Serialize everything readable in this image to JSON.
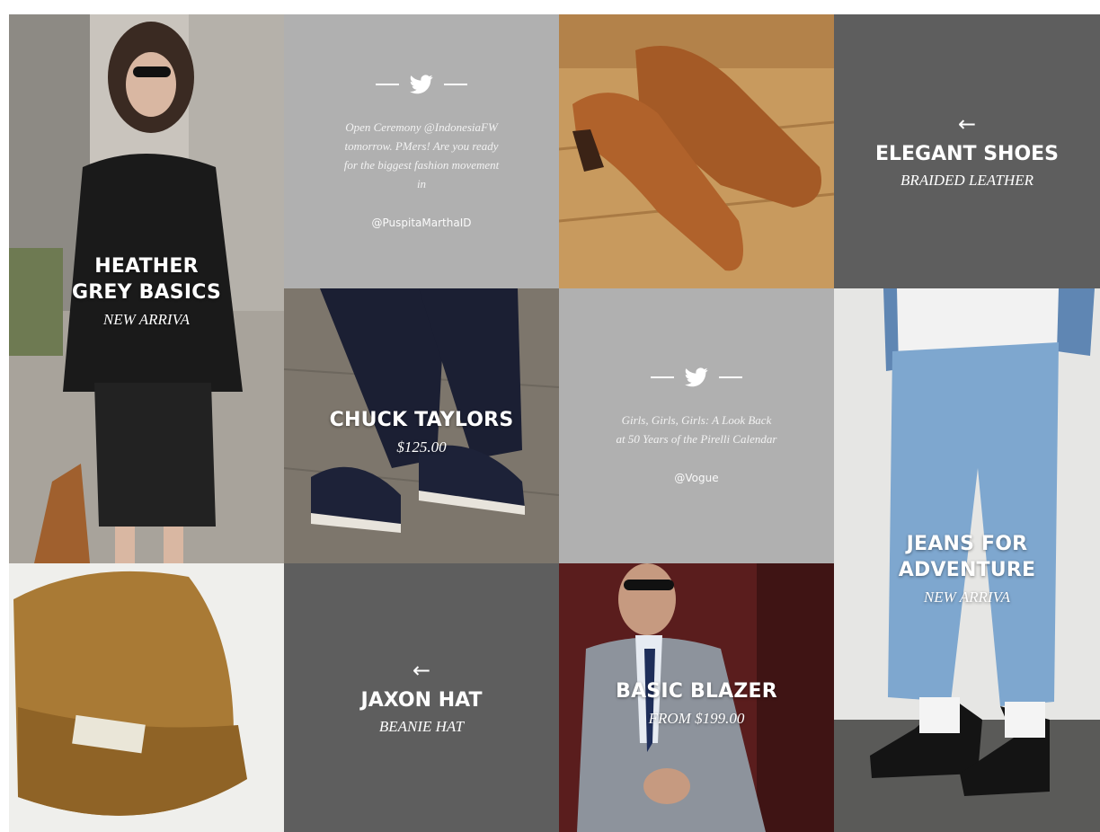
{
  "tiles": {
    "heather": {
      "title_line1": "HEATHER",
      "title_line2": "GREY BASICS",
      "subtitle": "NEW ARRIVA"
    },
    "tweet1": {
      "text": "Open Ceremony @IndonesiaFW tomorrow. PMers! Are you ready for the biggest fashion movement in",
      "handle": "@PuspitaMarthaID"
    },
    "shoes_photo": {},
    "elegant": {
      "arrow": "←",
      "title": "ELEGANT SHOES",
      "subtitle": "BRAIDED LEATHER"
    },
    "chuck": {
      "title": "CHUCK TAYLORS",
      "subtitle": "$125.00"
    },
    "tweet2": {
      "text": "Girls, Girls, Girls: A Look Back at 50 Years of the Pirelli Calendar",
      "handle": "@Vogue"
    },
    "jeans": {
      "title_line1": "JEANS FOR",
      "title_line2": "ADVENTURE",
      "subtitle": "NEW ARRIVA"
    },
    "jaxon": {
      "arrow": "←",
      "title": "JAXON HAT",
      "subtitle": "BEANIE HAT"
    },
    "blazer": {
      "title": "BASIC BLAZER",
      "subtitle": "FROM $199.00"
    }
  },
  "icons": {
    "tweet": "twitter-bird-icon",
    "arrow": "arrow-left-icon"
  },
  "colors": {
    "tweet_bg": "#b0b0b0",
    "dark_bg": "#5e5e5e",
    "text": "#ffffff"
  }
}
